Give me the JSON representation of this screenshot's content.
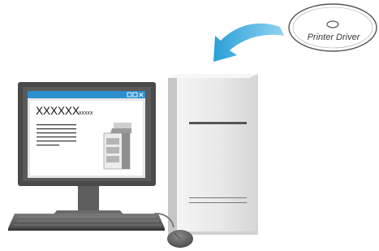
{
  "screen_window": {
    "heading": "XXXXXX",
    "subheading": "xxxxx",
    "titlebar_controls": "□□×"
  },
  "disc": {
    "label": "Printer Driver"
  },
  "colors": {
    "titlebar": "#2e8fd0",
    "arrow": "#35a9dd",
    "tower": "#e9e9e9",
    "monitor": "#4a4a4a"
  },
  "icons": {
    "install_arrow": "curved-arrow-icon",
    "printer": "printer-icon",
    "optical_disc": "cd-disc-icon",
    "mouse": "mouse-icon"
  }
}
